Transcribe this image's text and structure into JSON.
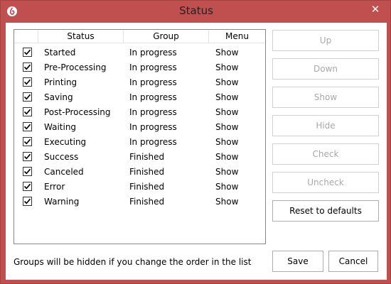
{
  "window": {
    "title": "Status",
    "close_symbol": "✕",
    "accent_color": "#c0504f",
    "app_icon": "app-logo-icon",
    "close_icon": "close-icon"
  },
  "table": {
    "columns": [
      "Status",
      "Group",
      "Menu"
    ],
    "rows": [
      {
        "checked": true,
        "status": "Started",
        "group": "In progress",
        "menu": "Show"
      },
      {
        "checked": true,
        "status": "Pre-Processing",
        "group": "In progress",
        "menu": "Show"
      },
      {
        "checked": true,
        "status": "Printing",
        "group": "In progress",
        "menu": "Show"
      },
      {
        "checked": true,
        "status": "Saving",
        "group": "In progress",
        "menu": "Show"
      },
      {
        "checked": true,
        "status": "Post-Processing",
        "group": "In progress",
        "menu": "Show"
      },
      {
        "checked": true,
        "status": "Waiting",
        "group": "In progress",
        "menu": "Show"
      },
      {
        "checked": true,
        "status": "Executing",
        "group": "In progress",
        "menu": "Show"
      },
      {
        "checked": true,
        "status": "Success",
        "group": "Finished",
        "menu": "Show"
      },
      {
        "checked": true,
        "status": "Canceled",
        "group": "Finished",
        "menu": "Show"
      },
      {
        "checked": true,
        "status": "Error",
        "group": "Finished",
        "menu": "Show"
      },
      {
        "checked": true,
        "status": "Warning",
        "group": "Finished",
        "menu": "Show"
      }
    ]
  },
  "buttons": {
    "up": "Up",
    "down": "Down",
    "show": "Show",
    "hide": "Hide",
    "check": "Check",
    "uncheck": "Uncheck",
    "reset": "Reset to defaults",
    "save": "Save",
    "cancel": "Cancel"
  },
  "footer": {
    "hint": "Groups will be hidden if you change the order in the list"
  }
}
